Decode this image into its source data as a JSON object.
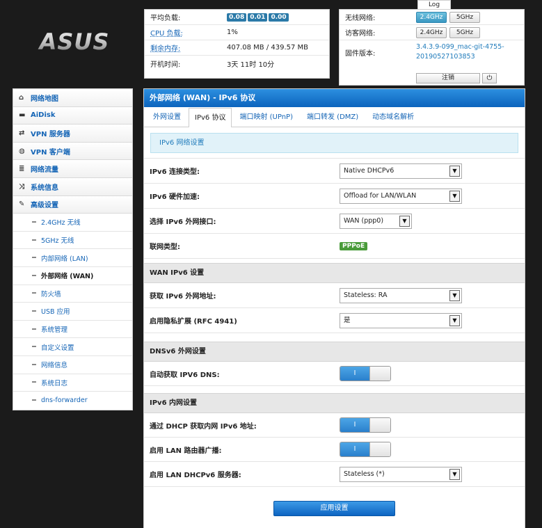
{
  "logo": {
    "text": "ASUS"
  },
  "status_left": {
    "rows": [
      {
        "label": "平均负载:",
        "badges": [
          "0.08",
          "0.01",
          "0.00"
        ]
      },
      {
        "label": "CPU 负载:",
        "value": "1%"
      },
      {
        "label": "剩余内存:",
        "value": "407.08 MB / 439.57 MB"
      },
      {
        "label": "开机时间:",
        "value": "3天 11时 10分"
      }
    ]
  },
  "status_right": {
    "wireless_label": "无线网络:",
    "guest_label": "访客网络:",
    "firmware_label": "固件版本:",
    "band_24": "2.4GHz",
    "band_5": "5GHz",
    "firmware_line1": "3.4.3.9-099_mac-git-4755-",
    "firmware_line2": "20190527103853",
    "log_label": "Log",
    "logout_label": "注销",
    "power_symbol": "⏻"
  },
  "sidebar": {
    "items": [
      {
        "label": "网络地图",
        "icon": "home-icon",
        "glyph": "⌂"
      },
      {
        "label": "AiDisk",
        "icon": "disk-icon",
        "glyph": "▬"
      },
      {
        "label": "VPN 服务器",
        "icon": "exchange-icon",
        "glyph": "⇄"
      },
      {
        "label": "VPN 客户端",
        "icon": "globe-icon",
        "glyph": "◍"
      },
      {
        "label": "网络流量",
        "icon": "list-icon",
        "glyph": "≣"
      },
      {
        "label": "系统信息",
        "icon": "shuffle-icon",
        "glyph": "⤨"
      },
      {
        "label": "高级设置",
        "icon": "wrench-icon",
        "glyph": "✎"
      }
    ],
    "subitems": [
      "2.4GHz 无线",
      "5GHz 无线",
      "内部网络 (LAN)",
      "外部网络 (WAN)",
      "防火墙",
      "USB 应用",
      "系统管理",
      "自定义设置",
      "网络信息",
      "系统日志",
      "dns-forwarder"
    ],
    "dash": "−"
  },
  "main": {
    "title": "外部网络 (WAN) - IPv6 协议",
    "tabs": [
      "外网设置",
      "IPv6 协议",
      "端口映射 (UPnP)",
      "端口转发 (DMZ)",
      "动态域名解析"
    ],
    "notice": "IPv6 网络设置",
    "rows1": {
      "conn_type_label": "IPv6 连接类型:",
      "conn_type_value": "Native DHCPv6",
      "hw_accel_label": "IPv6 硬件加速:",
      "hw_accel_value": "Offload for LAN/WLAN",
      "iface_label": "选择 IPv6 外网接口:",
      "iface_value": "WAN (ppp0)",
      "link_type_label": "联网类型:",
      "link_type_value": "PPPoE"
    },
    "wan_section": "WAN IPv6 设置",
    "rows2": {
      "addr_label": "获取 IPv6 外网地址:",
      "addr_value": "Stateless: RA",
      "privacy_label": "启用隐私扩展 (RFC 4941)",
      "privacy_value": "是"
    },
    "dns_section": "DNSv6 外网设置",
    "rows3": {
      "auto_dns_label": "自动获取 IPV6 DNS:"
    },
    "lan_section": "IPv6 内网设置",
    "rows4": {
      "dhcp_lan_label": "通过 DHCP 获取内网 IPv6 地址:",
      "ra_label": "启用 LAN 路由器广播:",
      "dhcpv6_server_label": "启用 LAN DHCPv6 服务器:",
      "dhcpv6_server_value": "Stateless (*)"
    },
    "toggle_on": "I",
    "select_arrow": "▼",
    "apply_label": "应用设置"
  }
}
